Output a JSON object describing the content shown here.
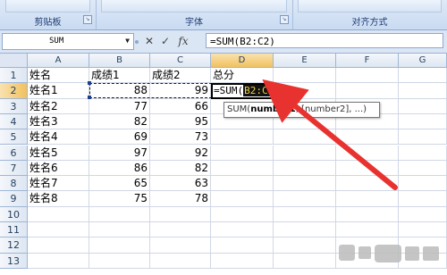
{
  "ribbon": {
    "groups": [
      {
        "label": "剪贴板",
        "launcher": "↘"
      },
      {
        "label": "字体",
        "launcher": "↘"
      },
      {
        "label": "对齐方式",
        "launcher": ""
      }
    ]
  },
  "formula_bar": {
    "name_box": "SUM",
    "dropdown_icon": "▼",
    "cancel": "✕",
    "enter": "✓",
    "fx": "fx",
    "formula": "=SUM(B2:C2)"
  },
  "columns": [
    "A",
    "B",
    "C",
    "D",
    "E",
    "F",
    "G"
  ],
  "rows": [
    "1",
    "2",
    "3",
    "4",
    "5",
    "6",
    "7",
    "8",
    "9",
    "10",
    "11",
    "12",
    "13"
  ],
  "cells": {
    "headers": [
      "姓名",
      "成绩1",
      "成绩2",
      "总分"
    ],
    "data": [
      [
        "姓名1",
        "88",
        "99"
      ],
      [
        "姓名2",
        "77",
        "66"
      ],
      [
        "姓名3",
        "82",
        "95"
      ],
      [
        "姓名4",
        "69",
        "73"
      ],
      [
        "姓名5",
        "97",
        "92"
      ],
      [
        "姓名6",
        "86",
        "82"
      ],
      [
        "姓名7",
        "65",
        "63"
      ],
      [
        "姓名8",
        "75",
        "78"
      ]
    ]
  },
  "active_cell": {
    "prefix": "=SUM(",
    "ref": "B2:C2",
    "suffix": ")"
  },
  "tooltip": {
    "fn": "SUM(",
    "arg1": "number1",
    "rest": ", [number2], ...)"
  },
  "colors": {
    "arrow": "#e8322f",
    "highlight_bg": "#111111",
    "highlight_fg": "#f1d23a"
  }
}
